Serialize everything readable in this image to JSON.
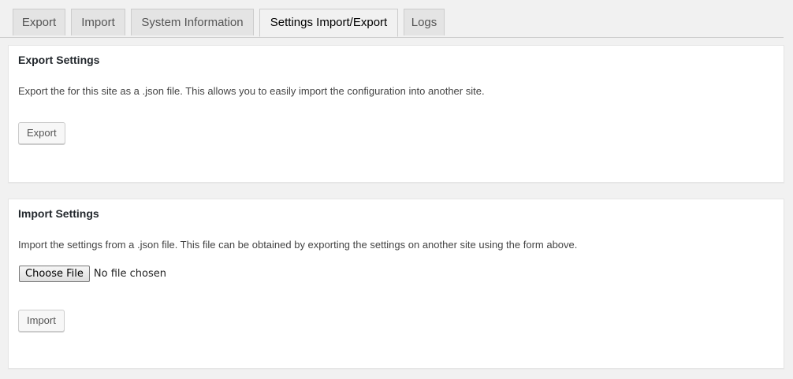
{
  "tabs": [
    {
      "label": "Export",
      "active": false
    },
    {
      "label": "Import",
      "active": false
    },
    {
      "label": "System Information",
      "active": false
    },
    {
      "label": "Settings Import/Export",
      "active": true
    },
    {
      "label": "Logs",
      "active": false
    }
  ],
  "export_panel": {
    "title": "Export Settings",
    "description": "Export the for this site as a .json file. This allows you to easily import the configuration into another site.",
    "button_label": "Export"
  },
  "import_panel": {
    "title": "Import Settings",
    "description": "Import the settings from a .json file. This file can be obtained by exporting the settings on another site using the form above.",
    "file_button_label": "Choose File",
    "file_status": "No file chosen",
    "button_label": "Import"
  }
}
